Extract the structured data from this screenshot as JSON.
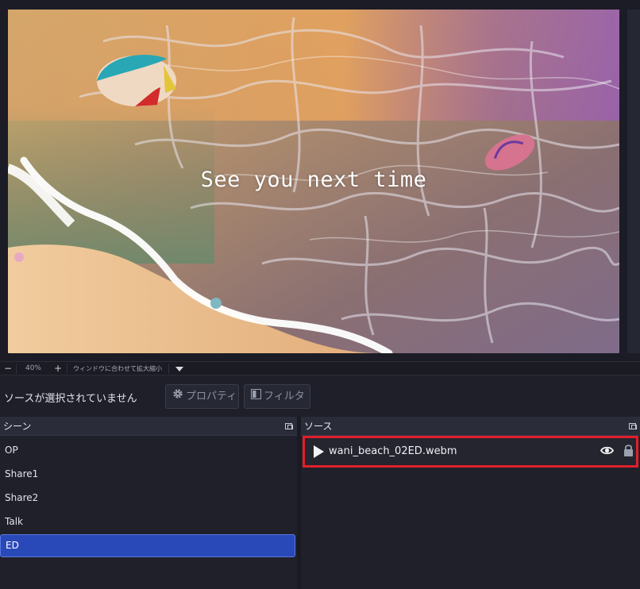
{
  "preview": {
    "overlay_text": "See you next time"
  },
  "zoom_bar": {
    "zoom_out_label": "−",
    "zoom_value": "40%",
    "zoom_in_label": "+",
    "fit_label": "ウィンドウに合わせて拡大縮小"
  },
  "toolbar": {
    "no_source_label": "ソースが選択されていません",
    "properties_label": "プロパティ",
    "filters_label": "フィルタ"
  },
  "scenes": {
    "title": "シーン",
    "items": [
      {
        "label": "OP"
      },
      {
        "label": "Share1"
      },
      {
        "label": "Share2"
      },
      {
        "label": "Talk"
      },
      {
        "label": "ED",
        "selected": true
      }
    ]
  },
  "sources": {
    "title": "ソース",
    "items": [
      {
        "label": "wani_beach_02ED.webm",
        "icon": "play-icon",
        "visible": true,
        "locked": true
      }
    ]
  },
  "colors": {
    "background": "#1e1f29",
    "selected_scene": "#2a49b8",
    "highlight_border": "#e0202b"
  }
}
